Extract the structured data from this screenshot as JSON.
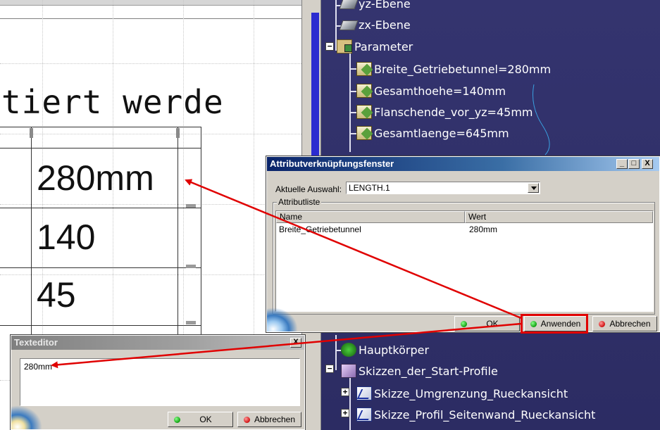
{
  "drawing": {
    "heading_fragment": "tiert werde",
    "table_values": [
      "280mm",
      "140",
      "45"
    ]
  },
  "tree": {
    "items": [
      {
        "label": "yz-Ebene",
        "icon": "plane-icon"
      },
      {
        "label": "zx-Ebene",
        "icon": "plane-icon"
      },
      {
        "label": "Parameter",
        "icon": "parameter-set-icon"
      },
      {
        "label": "Breite_Getriebetunnel=280mm",
        "icon": "formula-parameter-icon"
      },
      {
        "label": "Gesamthoehe=140mm",
        "icon": "formula-parameter-icon"
      },
      {
        "label": "Flanschende_vor_yz=45mm",
        "icon": "formula-parameter-icon"
      },
      {
        "label": "Gesamtlaenge=645mm",
        "icon": "formula-parameter-icon"
      },
      {
        "label": "Hauptkörper",
        "icon": "body-icon"
      },
      {
        "label": "Skizzen_der_Start-Profile",
        "icon": "sketch-set-icon"
      },
      {
        "label": "Skizze_Umgrenzung_Rueckansicht",
        "icon": "sketch-icon"
      },
      {
        "label": "Skizze_Profil_Seitenwand_Rueckansicht",
        "icon": "sketch-icon"
      }
    ]
  },
  "attribute_dialog": {
    "title": "Attributverknüpfungsfenster",
    "current_selection_label": "Aktuelle Auswahl:",
    "current_selection_value": "LENGTH.1",
    "group_label": "Attributliste",
    "columns": [
      "Name",
      "Wert"
    ],
    "rows": [
      {
        "name": "Breite_Getriebetunnel",
        "value": "280mm"
      }
    ],
    "buttons": {
      "ok": "OK",
      "apply": "Anwenden",
      "cancel": "Abbrechen"
    },
    "window_buttons": {
      "minimize": "_",
      "maximize": "□",
      "close": "X"
    }
  },
  "text_editor": {
    "title": "Texteditor",
    "content": "280mm",
    "buttons": {
      "ok": "OK",
      "cancel": "Abbrechen"
    }
  },
  "colors": {
    "tree_background": "#2f2f6b",
    "title_active": "#0a246a",
    "highlight": "#e00000",
    "arrow": "#e00000"
  }
}
